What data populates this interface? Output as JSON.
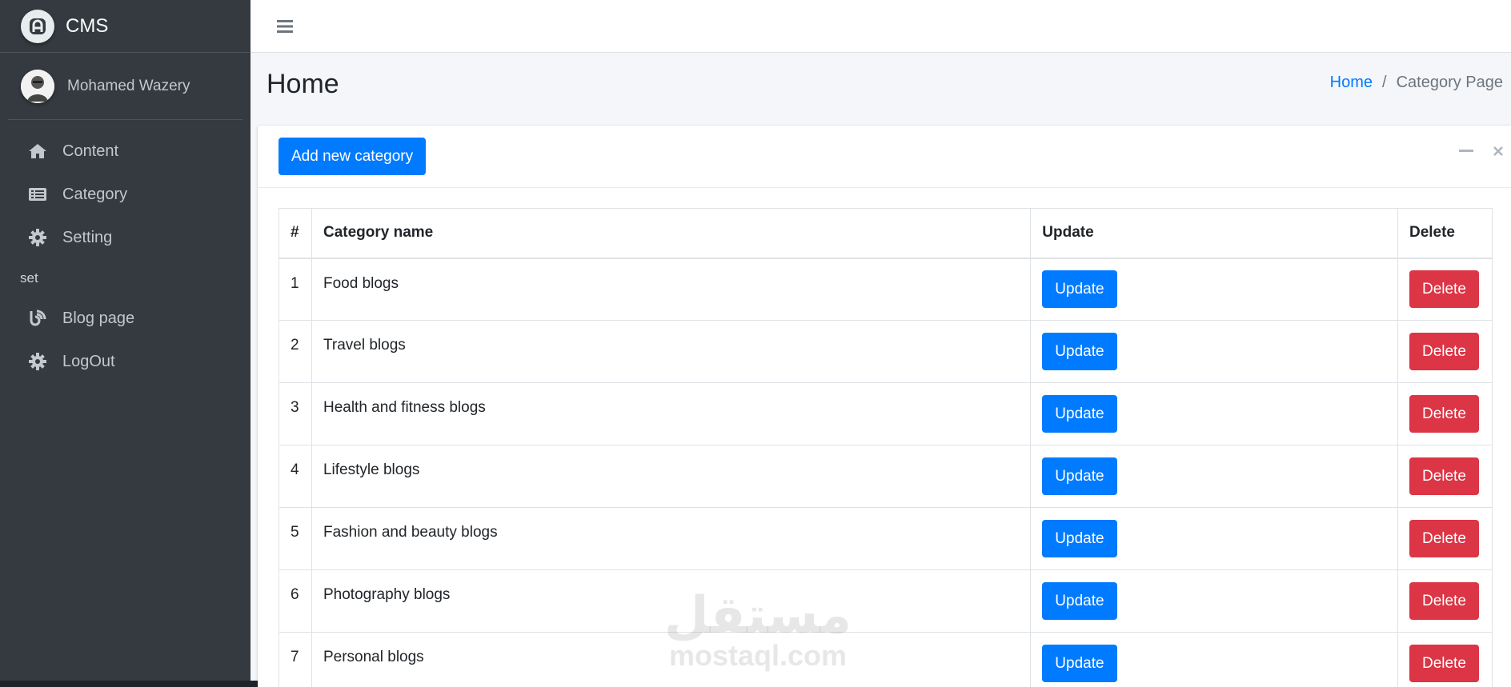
{
  "sidebar": {
    "brand": "CMS",
    "user_name": "Mohamed Wazery",
    "nav_items": [
      {
        "label": "Content",
        "icon": "home-icon"
      },
      {
        "label": "Category",
        "icon": "list-icon"
      },
      {
        "label": "Setting",
        "icon": "gear-icon"
      }
    ],
    "section_header": "set",
    "extra_items": [
      {
        "label": "Blog page",
        "icon": "blog-icon"
      },
      {
        "label": "LogOut",
        "icon": "gear-icon"
      }
    ]
  },
  "header": {
    "title": "Home",
    "breadcrumb": {
      "home": "Home",
      "separator": "/",
      "current": "Category Page"
    }
  },
  "card": {
    "add_button": "Add new category",
    "table": {
      "headers": [
        "#",
        "Category name",
        "Update",
        "Delete"
      ],
      "rows": [
        {
          "num": "1",
          "name": "Food blogs",
          "update": "Update",
          "delete": "Delete"
        },
        {
          "num": "2",
          "name": "Travel blogs",
          "update": "Update",
          "delete": "Delete"
        },
        {
          "num": "3",
          "name": "Health and fitness blogs",
          "update": "Update",
          "delete": "Delete"
        },
        {
          "num": "4",
          "name": "Lifestyle blogs",
          "update": "Update",
          "delete": "Delete"
        },
        {
          "num": "5",
          "name": "Fashion and beauty blogs",
          "update": "Update",
          "delete": "Delete"
        },
        {
          "num": "6",
          "name": "Photography blogs",
          "update": "Update",
          "delete": "Delete"
        },
        {
          "num": "7",
          "name": "Personal blogs",
          "update": "Update",
          "delete": "Delete"
        }
      ]
    }
  },
  "watermark": {
    "arabic": "مستقل",
    "latin": "mostaql.com"
  },
  "colors": {
    "primary": "#007bff",
    "danger": "#dc3545",
    "sidebar": "#343a40"
  }
}
